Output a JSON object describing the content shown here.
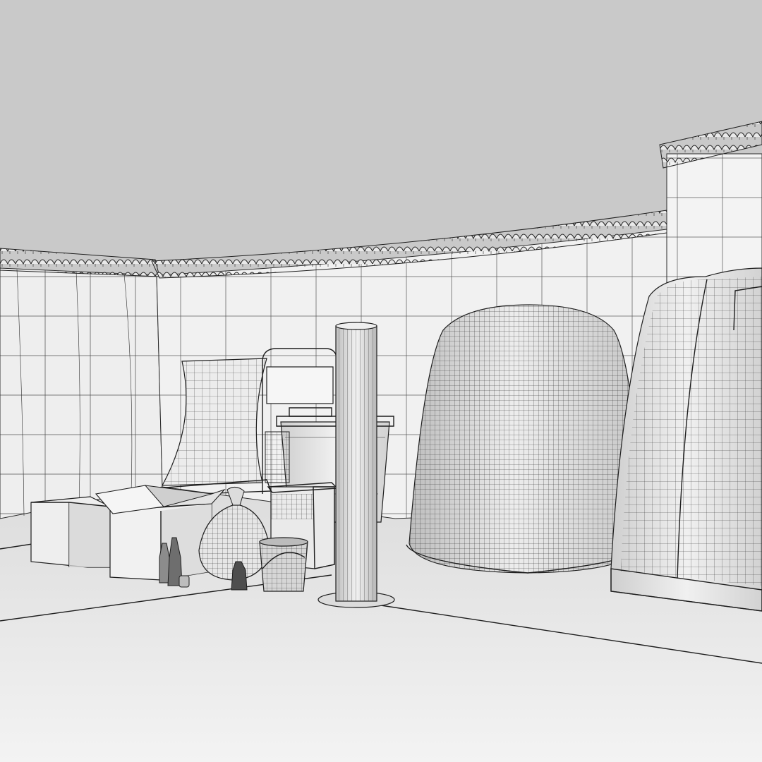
{
  "scene": {
    "kind": "wireframe-3d-render",
    "palette": {
      "sky": "#c9c9c9",
      "ground": "#ececec",
      "wall_light": "#f2f2f2",
      "wall_shade": "#e2e2e2",
      "wire": "#2b2b2b"
    },
    "objects": [
      "tiled-perimeter-wall",
      "roof-tile-coping",
      "wall-pillar",
      "cardboard-box-left",
      "cardboard-box-open",
      "curved-lounge-chair",
      "sign-board-frame",
      "wheelie-bin",
      "garbage-bag",
      "bucket",
      "glass-bottles",
      "plastic-crate",
      "cylindrical-bollard",
      "dome-compost-bin",
      "large-recycling-container"
    ]
  }
}
